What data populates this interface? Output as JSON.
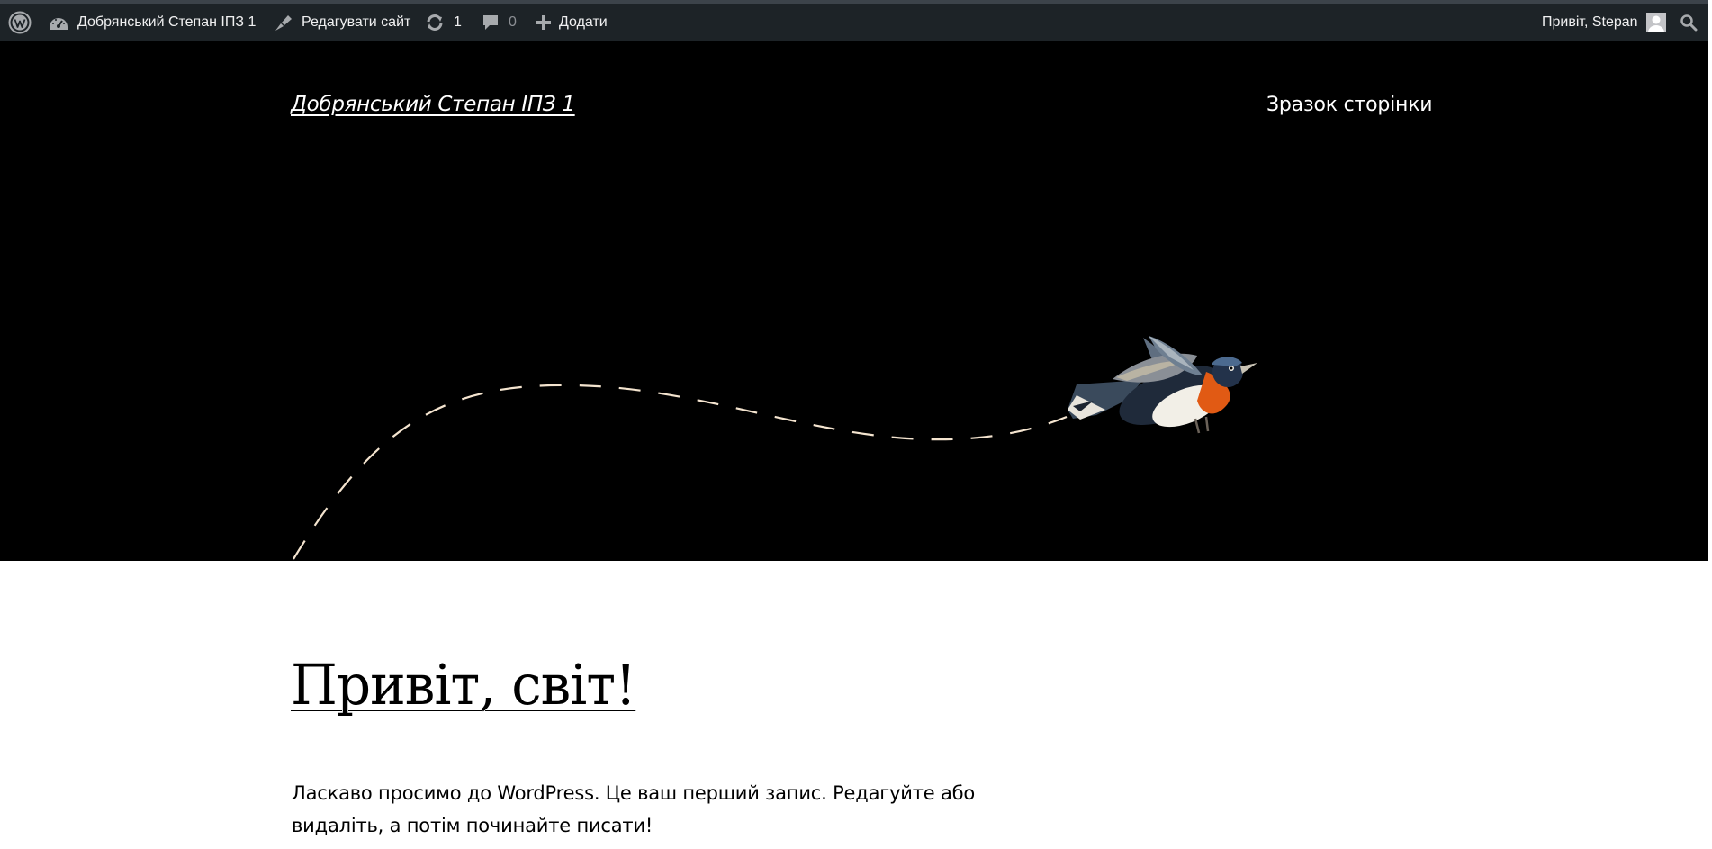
{
  "admin_bar": {
    "site_name": "Добрянський Степан ІПЗ 1",
    "edit_site_label": "Редагувати сайт",
    "updates_count": "1",
    "comments_count": "0",
    "new_label": "Додати",
    "greeting": "Привіт, Stepan",
    "background_color": "#1d2327"
  },
  "header": {
    "site_title": "Добрянський Степан ІПЗ 1",
    "nav": [
      "Зразок сторінки"
    ],
    "background_color": "#000000"
  },
  "post": {
    "title": "Привіт, світ!",
    "body": "Ласкаво просимо до WordPress. Це ваш перший запис. Редагуйте або видаліть, а потім починайте писати!"
  },
  "icons": {
    "wordpress": "wordpress-logo-icon",
    "dashboard": "dashboard-icon",
    "edit_site": "brush-icon",
    "updates": "updates-icon",
    "comments": "comment-icon",
    "new": "plus-icon",
    "search": "search-icon"
  }
}
